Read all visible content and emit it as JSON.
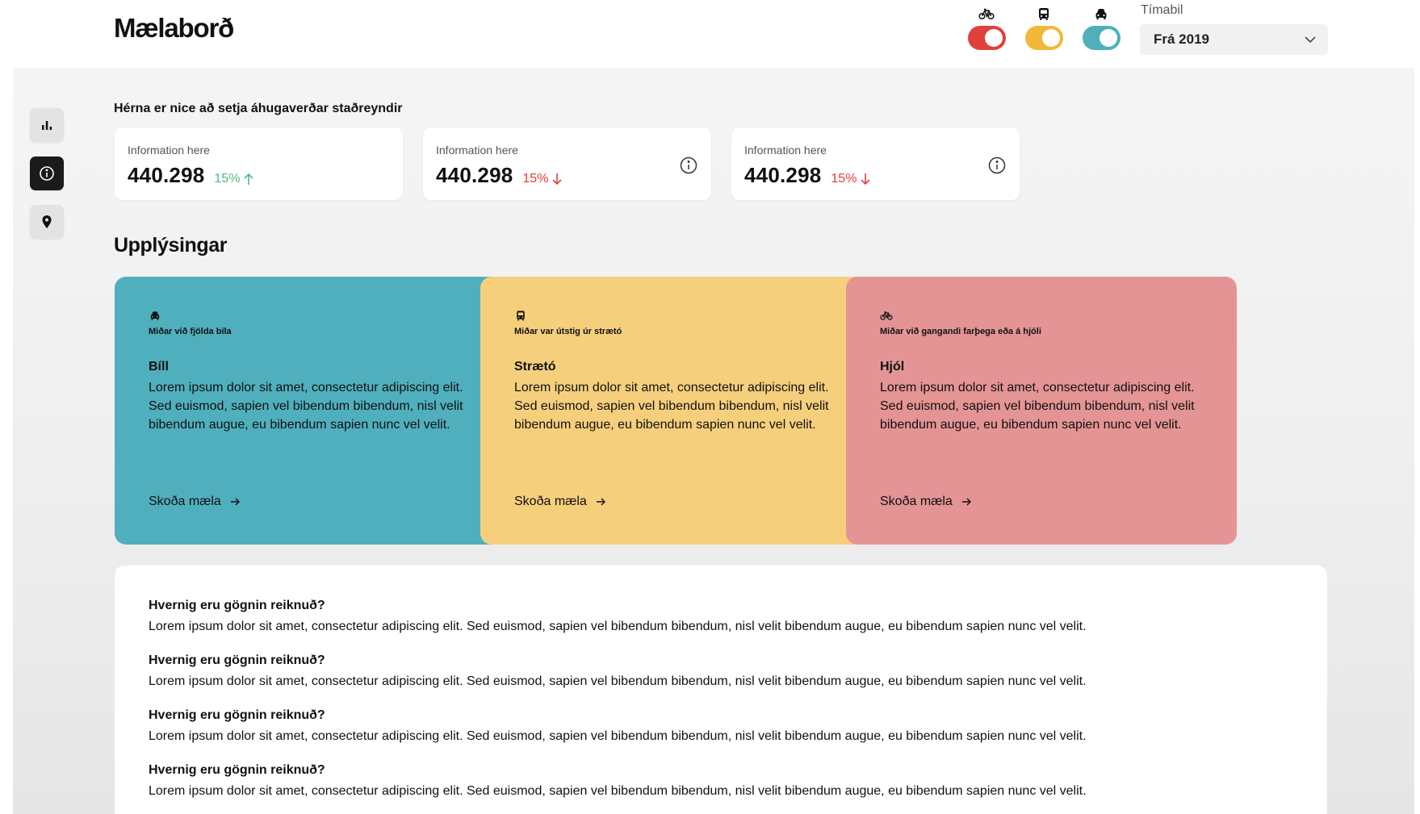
{
  "header": {
    "logo": "Mælaborð",
    "toggles": [
      {
        "id": "bike",
        "icon": "bicycle-icon",
        "color": "#e0413c"
      },
      {
        "id": "bus",
        "icon": "bus-icon",
        "color": "#f1b83b"
      },
      {
        "id": "car",
        "icon": "car-icon",
        "color": "#4fb0ba"
      }
    ],
    "period": {
      "label": "Tímabil",
      "selected": "Frá 2019"
    }
  },
  "sidebar": {
    "items": [
      {
        "icon": "bar-chart-icon",
        "active": false
      },
      {
        "icon": "info-icon",
        "active": true
      },
      {
        "icon": "map-pin-icon",
        "active": false
      }
    ]
  },
  "facts": {
    "title": "Hérna er nice að setja áhugaverðar staðreyndir",
    "cards": [
      {
        "label": "Information here",
        "value": "440.298",
        "change": "15%",
        "direction": "up",
        "color": "#4dbb86",
        "has_info": false
      },
      {
        "label": "Information here",
        "value": "440.298",
        "change": "15%",
        "direction": "down",
        "color": "#e0413c",
        "has_info": true
      },
      {
        "label": "Information here",
        "value": "440.298",
        "change": "15%",
        "direction": "down",
        "color": "#e0413c",
        "has_info": true
      }
    ]
  },
  "info": {
    "title": "Upplýsingar",
    "cards": [
      {
        "icon": "car-icon",
        "caption": "Miðar við fjölda bíla",
        "title": "Bíll",
        "text": "Lorem ipsum dolor sit amet, consectetur adipiscing elit. Sed euismod, sapien vel bibendum bibendum, nisl velit bibendum augue, eu bibendum sapien nunc vel velit.",
        "link": "Skoða mæla",
        "color": "#50afbd"
      },
      {
        "icon": "bus-icon",
        "caption": "Miðar var útstig úr strætó",
        "title": "Strætó",
        "text": "Lorem ipsum dolor sit amet, consectetur adipiscing elit. Sed euismod, sapien vel bibendum bibendum, nisl velit bibendum augue, eu bibendum sapien nunc vel velit.",
        "link": "Skoða mæla",
        "color": "#f6cf7d"
      },
      {
        "icon": "bicycle-icon",
        "caption": "Miðar við gangandi farþega eða á hjóli",
        "title": "Hjól",
        "text": "Lorem ipsum dolor sit amet, consectetur adipiscing elit. Sed euismod, sapien vel bibendum bibendum, nisl velit bibendum augue, eu bibendum sapien nunc vel velit.",
        "link": "Skoða mæla",
        "color": "#e49494"
      }
    ]
  },
  "faq": [
    {
      "question": "Hvernig eru gögnin reiknuð?",
      "answer": "Lorem ipsum dolor sit amet, consectetur adipiscing elit. Sed euismod, sapien vel bibendum bibendum, nisl velit bibendum augue, eu bibendum sapien nunc vel velit."
    },
    {
      "question": "Hvernig eru gögnin reiknuð?",
      "answer": "Lorem ipsum dolor sit amet, consectetur adipiscing elit. Sed euismod, sapien vel bibendum bibendum, nisl velit bibendum augue, eu bibendum sapien nunc vel velit."
    },
    {
      "question": "Hvernig eru gögnin reiknuð?",
      "answer": "Lorem ipsum dolor sit amet, consectetur adipiscing elit. Sed euismod, sapien vel bibendum bibendum, nisl velit bibendum augue, eu bibendum sapien nunc vel velit."
    },
    {
      "question": "Hvernig eru gögnin reiknuð?",
      "answer": "Lorem ipsum dolor sit amet, consectetur adipiscing elit. Sed euismod, sapien vel bibendum bibendum, nisl velit bibendum augue, eu bibendum sapien nunc vel velit."
    }
  ]
}
